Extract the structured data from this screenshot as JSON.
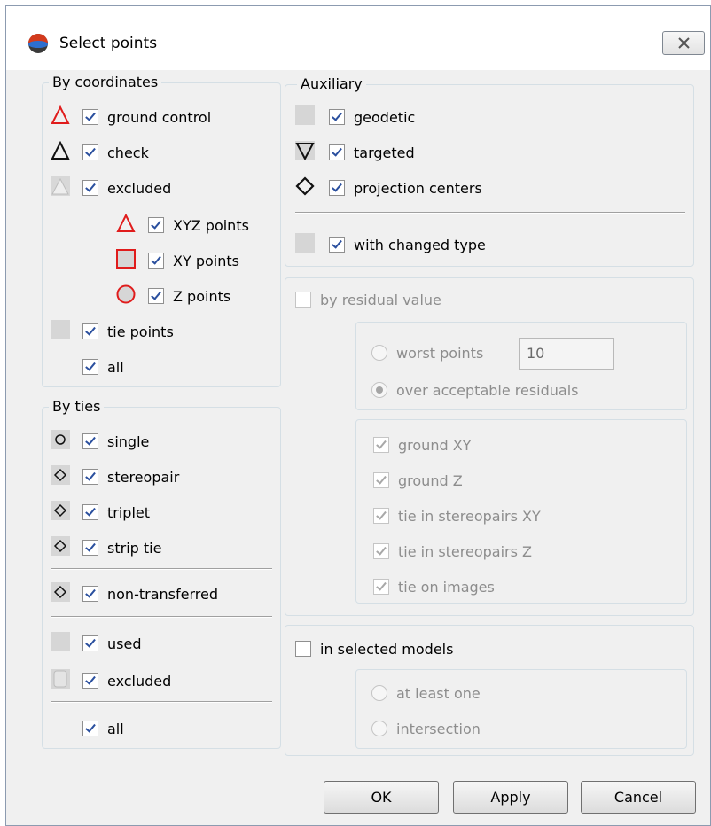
{
  "window": {
    "title": "Select points"
  },
  "by_coordinates": {
    "title": "By coordinates",
    "items": [
      {
        "label": "ground control",
        "checked": true,
        "icon": "red-triangle-icon"
      },
      {
        "label": "check",
        "checked": true,
        "icon": "black-triangle-icon"
      },
      {
        "label": "excluded",
        "checked": true,
        "icon": "gray-triangle-icon"
      },
      {
        "label": "XYZ points",
        "checked": true,
        "icon": "red-triangle-icon"
      },
      {
        "label": "XY points",
        "checked": true,
        "icon": "red-square-icon"
      },
      {
        "label": "Z points",
        "checked": true,
        "icon": "red-circle-icon"
      },
      {
        "label": "tie points",
        "checked": true,
        "icon": "gray-square-icon"
      },
      {
        "label": "all",
        "checked": true
      }
    ]
  },
  "by_ties": {
    "title": "By ties",
    "items": [
      {
        "label": "single",
        "checked": true,
        "icon": "circle-icon"
      },
      {
        "label": "stereopair",
        "checked": true,
        "icon": "diamond-icon"
      },
      {
        "label": "triplet",
        "checked": true,
        "icon": "diamond-icon"
      },
      {
        "label": "strip tie",
        "checked": true,
        "icon": "diamond-icon"
      },
      {
        "label": "non-transferred",
        "checked": true,
        "icon": "diamond-icon"
      },
      {
        "label": "used",
        "checked": true,
        "icon": "gray-square-icon"
      },
      {
        "label": "excluded",
        "checked": true,
        "icon": "gray-rounded-square-icon"
      },
      {
        "label": "all",
        "checked": true
      }
    ]
  },
  "auxiliary": {
    "title": "Auxiliary",
    "items": [
      {
        "label": "geodetic",
        "checked": true,
        "icon": "gray-square-icon"
      },
      {
        "label": "targeted",
        "checked": true,
        "icon": "inverted-triangle-icon"
      },
      {
        "label": "projection centers",
        "checked": true,
        "icon": "diamond-icon"
      },
      {
        "label": "with changed type",
        "checked": true,
        "icon": "gray-square-icon"
      }
    ]
  },
  "residual": {
    "label": "by residual value",
    "checked": false,
    "worst_points_label": "worst points",
    "worst_points_value": "10",
    "over_acceptable_label": "over acceptable residuals",
    "selected_option": "over acceptable residuals",
    "types": [
      {
        "label": "ground XY",
        "checked": true
      },
      {
        "label": "ground Z",
        "checked": true
      },
      {
        "label": "tie in stereopairs XY",
        "checked": true
      },
      {
        "label": "tie in stereopairs Z",
        "checked": true
      },
      {
        "label": "tie on images",
        "checked": true
      }
    ]
  },
  "models": {
    "label": "in selected models",
    "checked": false,
    "options": [
      {
        "label": "at least one"
      },
      {
        "label": "intersection"
      }
    ]
  },
  "buttons": {
    "ok": "OK",
    "apply": "Apply",
    "cancel": "Cancel"
  },
  "colors": {
    "marker_red": "#e01c1c",
    "checkmark": "#2a4f9e",
    "dialog_bg": "#f0f0f0"
  }
}
